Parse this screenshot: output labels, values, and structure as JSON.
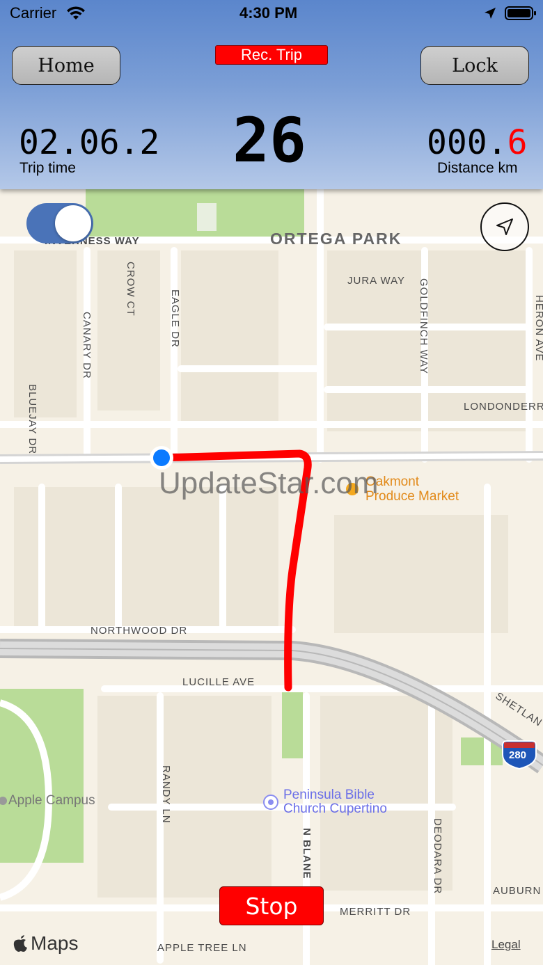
{
  "status_bar": {
    "carrier": "Carrier",
    "time": "4:30 PM"
  },
  "header": {
    "home_label": "Home",
    "lock_label": "Lock",
    "rec_label": "Rec. Trip",
    "speed": "26",
    "trip_time_value": "02.06.2",
    "trip_time_label": "Trip time",
    "distance_value_main": "000.",
    "distance_value_decimal": "6",
    "distance_label": "Distance km"
  },
  "map": {
    "labels": {
      "park": "ORTEGA PARK",
      "inverness": "INVERNESS WAY",
      "crow": "CROW CT",
      "eagle": "EAGLE DR",
      "canary": "CANARY DR",
      "bluejay": "BLUEJAY DR",
      "jura": "JURA WAY",
      "goldfinch": "GOLDFINCH WAY",
      "heron": "HERON AVE",
      "londonderry": "LONDONDERRY",
      "northwood": "NORTHWOOD DR",
      "lucille": "LUCILLE AVE",
      "shetland": "SHETLAN",
      "randy": "RANDY LN",
      "blaney": "N BLANE",
      "deodara": "DEODARA DR",
      "auburn": "AUBURN",
      "merritt": "MERRITT DR",
      "apple_tree": "APPLE TREE LN",
      "highway": "280"
    },
    "pois": {
      "oakmont_1": "Oakmont",
      "oakmont_2": "Produce Market",
      "apple_campus": "Apple Campus",
      "church_1": "Peninsula Bible",
      "church_2": "Church Cupertino"
    },
    "watermark": "UpdateStar.com",
    "attribution": "Maps",
    "legal": "Legal"
  },
  "controls": {
    "stop_label": "Stop",
    "toggle_on": true
  },
  "colors": {
    "route": "#ff0000",
    "header_top": "#5b86cc",
    "accent_red": "#ff0000",
    "location_dot": "#0a7aff"
  },
  "icons": {
    "wifi": "wifi-icon",
    "location_arrow": "location-arrow-icon",
    "battery": "battery-icon",
    "navigate": "navigate-icon",
    "apple": "apple-icon"
  }
}
